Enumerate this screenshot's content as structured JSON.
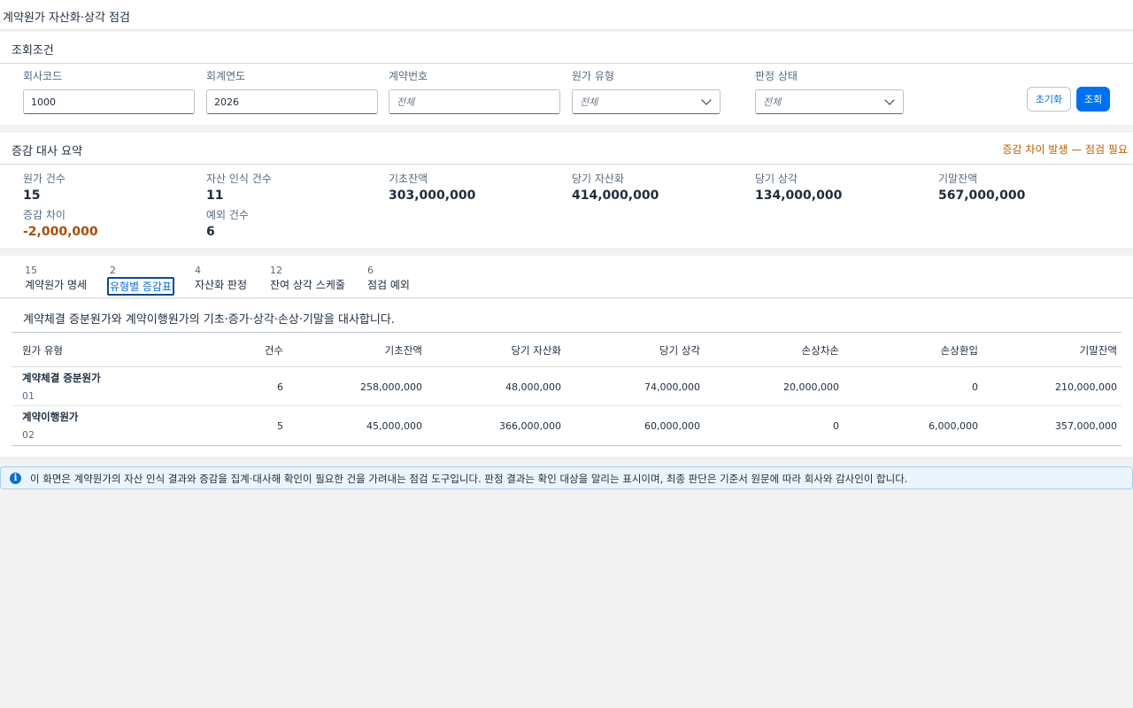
{
  "page": {
    "title": "계약원가 자산화·상각 점검"
  },
  "filters": {
    "title": "조회조건",
    "company_code": {
      "label": "회사코드",
      "value": "1000"
    },
    "fiscal_year": {
      "label": "회계연도",
      "value": "2026"
    },
    "contract_no": {
      "label": "계약번호",
      "placeholder": "전체"
    },
    "cost_type": {
      "label": "원가 유형",
      "value": "전체"
    },
    "judgement_status": {
      "label": "판정 상태",
      "value": "전체"
    },
    "reset_label": "초기화",
    "search_label": "조회"
  },
  "summary": {
    "title": "증감 대사 요약",
    "warning": "증감 차이 발생 — 점검 필요",
    "kpis": [
      {
        "label": "원가 건수",
        "value": "15"
      },
      {
        "label": "자산 인식 건수",
        "value": "11"
      },
      {
        "label": "기초잔액",
        "value": "303,000,000"
      },
      {
        "label": "당기 자산화",
        "value": "414,000,000"
      },
      {
        "label": "당기 상각",
        "value": "134,000,000"
      },
      {
        "label": "기말잔액",
        "value": "567,000,000"
      },
      {
        "label": "증감 차이",
        "value": "-2,000,000"
      },
      {
        "label": "예외 건수",
        "value": "6"
      }
    ],
    "colors": {
      "warning": "#b75f00",
      "negative": "#a94e07"
    }
  },
  "tabs": [
    {
      "count": "15",
      "label": "계약원가 명세"
    },
    {
      "count": "2",
      "label": "유형별 증감표"
    },
    {
      "count": "4",
      "label": "자산화 판정"
    },
    {
      "count": "12",
      "label": "잔여 상각 스케줄"
    },
    {
      "count": "6",
      "label": "점검 예외"
    }
  ],
  "active_tab": "유형별 증감표",
  "table": {
    "description": "계약체결 증분원가와 계약이행원가의 기초·증가·상각·손상·기말을 대사합니다.",
    "columns": [
      "원가 유형",
      "건수",
      "기초잔액",
      "당기 자산화",
      "당기 상각",
      "손상차손",
      "손상환입",
      "기말잔액"
    ],
    "rows": [
      {
        "name": "계약체결 증분원가",
        "code": "01",
        "count": "6",
        "opening": "258,000,000",
        "capitalized": "48,000,000",
        "amortization": "74,000,000",
        "impairment": "20,000,000",
        "reversal": "0",
        "closing": "210,000,000"
      },
      {
        "name": "계약이행원가",
        "code": "02",
        "count": "5",
        "opening": "45,000,000",
        "capitalized": "366,000,000",
        "amortization": "60,000,000",
        "impairment": "0",
        "reversal": "6,000,000",
        "closing": "357,000,000"
      }
    ]
  },
  "info": {
    "icon": "info-icon",
    "text": "이 화면은 계약원가의 자산 인식 결과와 증감을 집계·대사해 확인이 필요한 건을 가려내는 점검 도구입니다. 판정 결과는 확인 대상을 알리는 표시이며, 최종 판단은 기준서 원문에 따라 회사와 감사인이 합니다."
  },
  "accent_color": "#0070f2"
}
